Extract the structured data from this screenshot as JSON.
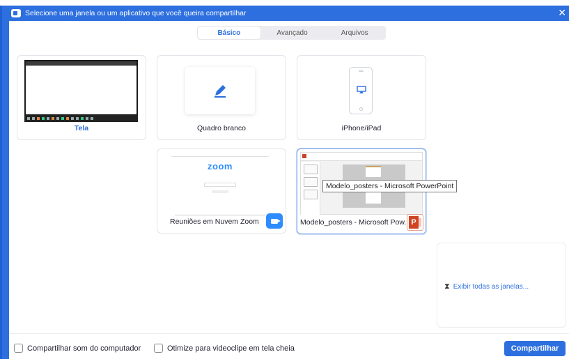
{
  "window": {
    "title": "Selecione uma janela ou um aplicativo que você queira compartilhar",
    "close_glyph": "✕"
  },
  "tabs": [
    {
      "label": "Básico",
      "active": true
    },
    {
      "label": "Avançado",
      "active": false
    },
    {
      "label": "Arquivos",
      "active": false
    }
  ],
  "cards": {
    "tela": {
      "label": "Tela"
    },
    "whiteboard": {
      "label": "Quadro branco"
    },
    "iphone": {
      "label": "iPhone/iPad"
    },
    "zoom": {
      "label": "Reuniões em Nuvem Zoom",
      "logo_text": "zoom"
    },
    "powerpoint": {
      "label": "Modelo_posters - Microsoft Pow...",
      "tooltip": "Modelo_posters - Microsoft PowerPoint",
      "badge_letter": "P"
    }
  },
  "show_all": {
    "label": "Exibir todas as janelas...",
    "icon": "⧗"
  },
  "footer": {
    "share_sound_label": "Compartilhar som do computador",
    "optimize_label": "Otimize para videoclipe em tela cheia",
    "share_button": "Compartilhar"
  },
  "colors": {
    "accent": "#2d6fdf",
    "zoom_blue": "#2d8cff",
    "ppt_orange": "#d04423"
  }
}
